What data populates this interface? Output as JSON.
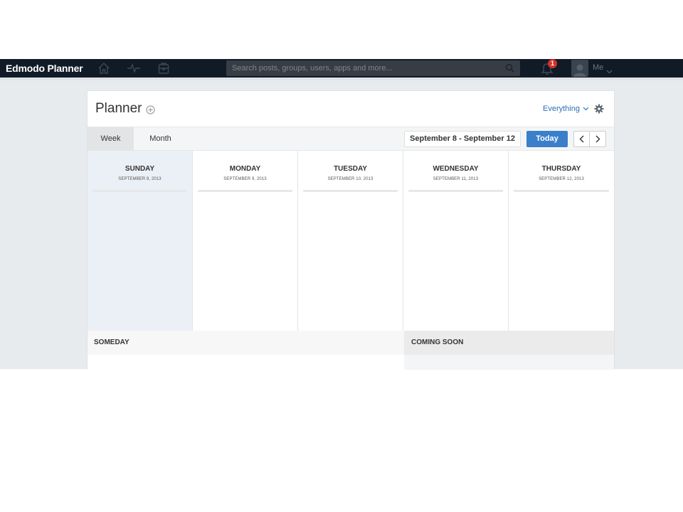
{
  "navbar": {
    "brand": "Edmodo Planner",
    "icons": [
      "home-icon",
      "activity-icon",
      "backpack-icon"
    ],
    "search_placeholder": "Search posts, groups, users, apps and more...",
    "notification_count": "1",
    "user_label": "Me"
  },
  "planner": {
    "title": "Planner",
    "filter_label": "Everything",
    "tabs": {
      "week": "Week",
      "month": "Month"
    },
    "date_range": "September 8 - September 12",
    "today_label": "Today",
    "days": [
      {
        "name": "SUNDAY",
        "date": "SEPTEMBER 8, 2013"
      },
      {
        "name": "MONDAY",
        "date": "SEPTEMBER 9, 2013"
      },
      {
        "name": "TUESDAY",
        "date": "SEPTEMBER 10, 2013"
      },
      {
        "name": "WEDNESDAY",
        "date": "SEPTEMBER 11, 2013"
      },
      {
        "name": "THURSDAY",
        "date": "SEPTEMBER 12, 2013"
      }
    ],
    "someday_label": "SOMEDAY",
    "coming_soon_label": "COMING SOON"
  },
  "colors": {
    "navbar_bg": "#111b27",
    "accent": "#3b7fcb",
    "link": "#2c6fb7",
    "badge": "#d3302b",
    "highlight_day": "#ebeff6"
  }
}
